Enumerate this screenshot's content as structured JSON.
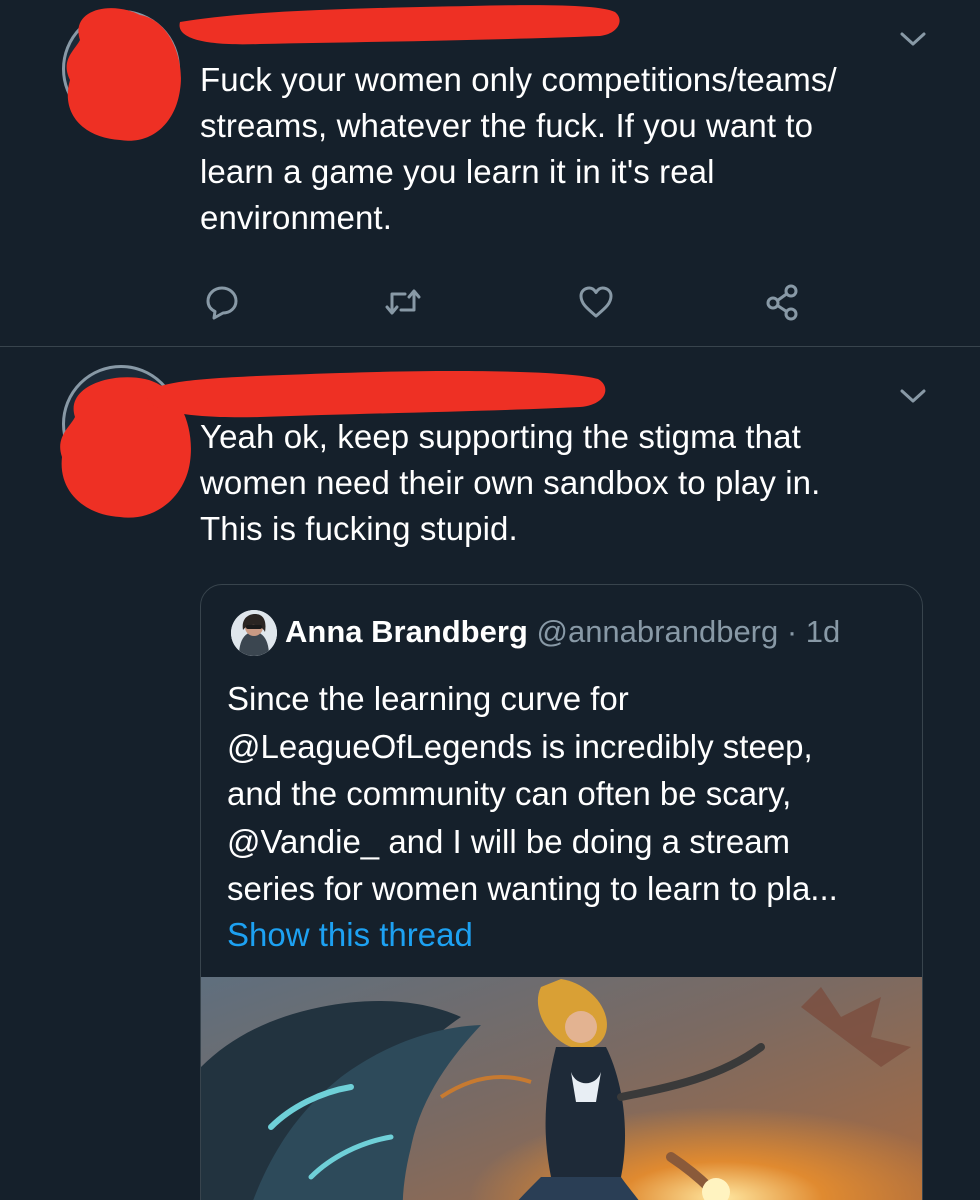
{
  "tweets": [
    {
      "text_lines": [
        "Fuck your women only competitions/teams/",
        "streams, whatever the fuck. If you want to",
        "learn a game you learn it in it's real",
        "environment."
      ],
      "actions": {
        "reply_icon": "reply-icon",
        "retweet_icon": "retweet-icon",
        "like_icon": "heart-icon",
        "share_icon": "share-icon"
      }
    },
    {
      "text_lines": [
        "Yeah ok, keep supporting the stigma that",
        "women need their own sandbox  to play in.",
        "This is fucking stupid."
      ],
      "quoted_tweet": {
        "author_name": "Anna Brandberg",
        "author_handle": "@annabrandberg",
        "time": "· 1d",
        "text_lines": [
          "Since the learning curve for",
          "@LeagueOfLegends is incredibly steep,",
          "and the community can often be scary,",
          "@Vandie_ and I will be doing a stream",
          "series for women wanting to learn to pla..."
        ],
        "show_thread": "Show this thread"
      }
    }
  ],
  "colors": {
    "background": "#15202b",
    "divider": "#38444d",
    "secondary_text": "#8899a6",
    "link": "#1da1f2",
    "redaction": "#ee3024"
  }
}
